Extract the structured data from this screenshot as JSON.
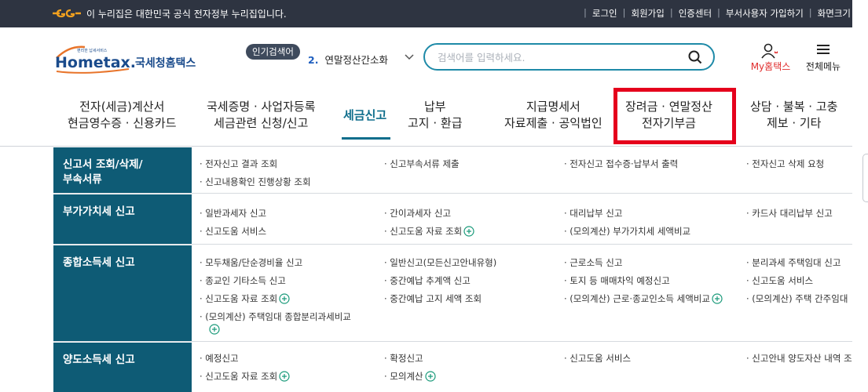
{
  "gov_bar": {
    "notice": "이 누리집은 대한민국 공식 전자정부 누리집입니다.",
    "links": [
      "로그인",
      "회원가입",
      "인증센터",
      "부서사용자 가입하기",
      "화면크기"
    ]
  },
  "header": {
    "logo_small": "편리한 납세서비스",
    "logo_main": "Hometax.",
    "logo_korean": "국세청홈택스",
    "popular_label": "인기검색어",
    "popular_rank": "2.",
    "popular_term": "연말정산간소화",
    "search_placeholder": "검색어를 입력하세요.",
    "my_home": "My홈택스",
    "all_menu": "전체메뉴"
  },
  "nav": {
    "items": [
      {
        "line1": "전자(세금)계산서",
        "line2": "현금영수증 · 신용카드"
      },
      {
        "line1": "국세증명 · 사업자등록",
        "line2": "세금관련 신청/신고"
      },
      {
        "line1": "세금신고",
        "line2": ""
      },
      {
        "line1": "납부",
        "line2": "고지 · 환급"
      },
      {
        "line1": "지급명세서",
        "line2": "자료제출 · 공익법인"
      },
      {
        "line1": "장려금 · 연말정산",
        "line2": "전자기부금"
      },
      {
        "line1": "상담 · 불복 · 고충",
        "line2": "제보 · 기타"
      }
    ]
  },
  "rows": [
    {
      "category_line1": "신고서 조회/삭제/",
      "category_line2": "부속서류",
      "links": [
        "· 전자신고 결과 조회",
        "· 신고부속서류 제출",
        "· 전자신고 접수증·납부서 출력",
        "· 전자신고 삭제 요청",
        "· 신고내용확인 진행상황 조회"
      ]
    },
    {
      "category_line1": "부가가치세 신고",
      "links": [
        "· 일반과세자 신고",
        "· 간이과세자 신고",
        "· 대리납부 신고",
        "· 카드사 대리납부 신고",
        "· 신고도움 서비스",
        "· 신고도움 자료 조회",
        "· (모의계산) 부가가치세 세액비교"
      ]
    },
    {
      "category_line1": "종합소득세 신고",
      "links": [
        "· 모두채움/단순경비율 신고",
        "· 일반신고(모든신고안내유형)",
        "· 근로소득 신고",
        "· 분리과세 주택임대 신고",
        "· 종교인 기타소득 신고",
        "· 중간예납 추계액 신고",
        "· 토지 등 매매차익 예정신고",
        "· 신고도움 서비스",
        "· 신고도움 자료 조회",
        "· 중간예납 고지 세액 조회",
        "· (모의계산) 근로·종교인소득 세액비교",
        "· (모의계산) 주택 간주임대",
        "· (모의계산) 주택임대 종합분리과세비교"
      ]
    },
    {
      "category_line1": "양도소득세 신고",
      "links": [
        "· 예정신고",
        "· 확정신고",
        "· 신고도움 서비스",
        "· 신고안내 양도자산 내역 조",
        "· 신고도움 자료 조회",
        "· 모의계산"
      ]
    }
  ],
  "colors": {
    "gov_bar": "#2e3441",
    "category_bg": "#0e5b75",
    "accent": "#0f6e8c",
    "search_border": "#1e8aa8",
    "highlight": "#e5001c",
    "my_home": "#e02d2d"
  }
}
